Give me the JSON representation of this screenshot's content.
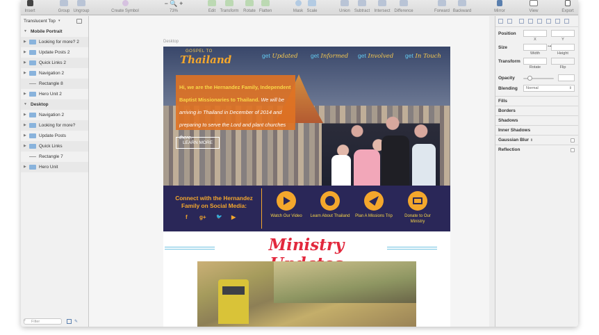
{
  "toolbar": {
    "insert": "Insert",
    "group": "Group",
    "ungroup": "Ungroup",
    "create_symbol": "Create Symbol",
    "zoom": "73%",
    "edit": "Edit",
    "transform": "Transform",
    "rotate": "Rotate",
    "flatten": "Flatten",
    "mask": "Mask",
    "scale": "Scale",
    "union": "Union",
    "subtract": "Subtract",
    "intersect": "Intersect",
    "difference": "Difference",
    "forward": "Forward",
    "backward": "Backward",
    "mirror": "Mirror",
    "view": "View",
    "export": "Export"
  },
  "layers": {
    "page_selector": "Translucent Top",
    "items": [
      {
        "label": "Mobile Portrait",
        "kind": "group"
      },
      {
        "label": "Looking for more? 2",
        "kind": "folder"
      },
      {
        "label": "Update Posts 2",
        "kind": "folder"
      },
      {
        "label": "Quick Links 2",
        "kind": "folder"
      },
      {
        "label": "Navigation 2",
        "kind": "folder"
      },
      {
        "label": "Rectangle 8",
        "kind": "rect"
      },
      {
        "label": "Hero Unit 2",
        "kind": "folder"
      },
      {
        "label": "Desktop",
        "kind": "group"
      },
      {
        "label": "Navigation 2",
        "kind": "folder"
      },
      {
        "label": "Looking for more?",
        "kind": "folder"
      },
      {
        "label": "Update Posts",
        "kind": "folder"
      },
      {
        "label": "Quick Links",
        "kind": "folder"
      },
      {
        "label": "Rectangle 7",
        "kind": "rect"
      },
      {
        "label": "Hero Unit",
        "kind": "folder"
      }
    ],
    "filter_placeholder": "Filter"
  },
  "canvas": {
    "artboard_label": "Desktop",
    "logo_small": "GOSPEL TO",
    "logo_big": "Thailand",
    "nav": [
      {
        "pre": "get",
        "word": "Updated"
      },
      {
        "pre": "get",
        "word": "Informed"
      },
      {
        "pre": "get",
        "word": "Involved"
      },
      {
        "pre": "get",
        "word": "In Touch"
      }
    ],
    "callout_bold": "Hi, we are the Hernandez Family, Independent Baptist Missionaries to Thailand.",
    "callout_italic": " We will be arriving in Thailand in December of 2014 and preparing to serve the Lord and plant churches there.",
    "learn_more": "LEARN MORE",
    "connect_text": "Connect with the Hernandez Family on Social Media:",
    "social_icons": [
      "f",
      "g+",
      "t",
      "yt"
    ],
    "actions": [
      {
        "label": "Watch Our Video",
        "icon": "play-icon"
      },
      {
        "label": "Learn About Thailand",
        "icon": "globe-icon"
      },
      {
        "label": "Plan A Missions Trip",
        "icon": "paper-plane-icon"
      },
      {
        "label": "Donate to Our Ministry",
        "icon": "credit-card-icon"
      }
    ],
    "updates_title": "Ministry Updates"
  },
  "inspector": {
    "position": "Position",
    "x": "X",
    "y": "Y",
    "size": "Size",
    "width": "Width",
    "height": "Height",
    "transform": "Transform",
    "rotate": "Rotate",
    "flip": "Flip",
    "opacity": "Opacity",
    "blending": "Blending",
    "blending_value": "Normal",
    "fills": "Fills",
    "borders": "Borders",
    "shadows": "Shadows",
    "inner_shadows": "Inner Shadows",
    "gaussian_blur": "Gaussian Blur",
    "reflection": "Reflection"
  },
  "colors": {
    "accent_orange": "#f4a72c",
    "navy": "#2a2758",
    "title_red": "#e2283d",
    "nav_blue": "#62c7ef"
  }
}
